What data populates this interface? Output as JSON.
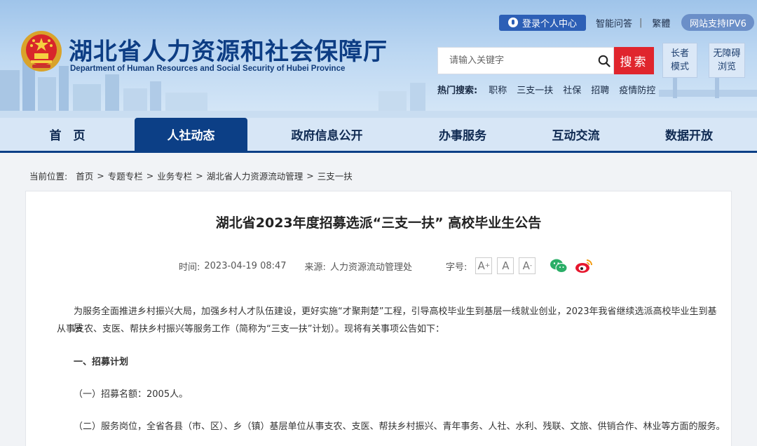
{
  "header": {
    "title": "湖北省人力资源和社会保障厅",
    "subtitle": "Department of Human Resources and Social Security of Hubei Province",
    "login_label": "登录个人中心",
    "qa_label": "智能问答",
    "separator": "|",
    "traditional_label": "繁體",
    "ipv6_label": "网站支持IPV6",
    "search_placeholder": "请输入关键字",
    "search_button": "搜索",
    "elder_mode": [
      "长者",
      "模式"
    ],
    "accessible": [
      "无障碍",
      "浏览"
    ],
    "hot_label": "热门搜索:",
    "hot_keywords": [
      "职称",
      "三支一扶",
      "社保",
      "招聘",
      "疫情防控"
    ]
  },
  "nav": [
    "首　页",
    "人社动态",
    "政府信息公开",
    "办事服务",
    "互动交流",
    "数据开放"
  ],
  "breadcrumb": {
    "label": "当前位置:",
    "items": [
      "首页",
      "专题专栏",
      "业务专栏",
      "湖北省人力资源流动管理",
      "三支一扶"
    ],
    "arrow": ">"
  },
  "article": {
    "title": "湖北省2023年度招募选派“三支一扶” 高校毕业生公告",
    "time_label": "时间:",
    "time_value": "2023-04-19 08:47",
    "source_label": "来源:",
    "source_value": "人力资源流动管理处",
    "fontsize_label": "字号:",
    "paragraphs": [
      "为服务全面推进乡村振兴大局，加强乡村人才队伍建设，更好实施“才聚荆楚”工程，引导高校毕业生到基层一线就业创业，2023年我省继续选派高校毕业生到基层",
      "从事支农、支医、帮扶乡村振兴等服务工作（简称为“三支一扶”计划）。现将有关事项公告如下：",
      "一、招募计划",
      "（一）招募名额：2005人。",
      "（二）服务岗位，全省各县（市、区）、乡（镇）基层单位从事支农、支医、帮扶乡村振兴、青年事务、人社、水利、残联、文旅、供销合作、林业等方面的服务。"
    ]
  },
  "colors": {
    "brand": "#0c3f86",
    "search_red": "#e0252d",
    "login_blue": "#2d5fb6"
  }
}
